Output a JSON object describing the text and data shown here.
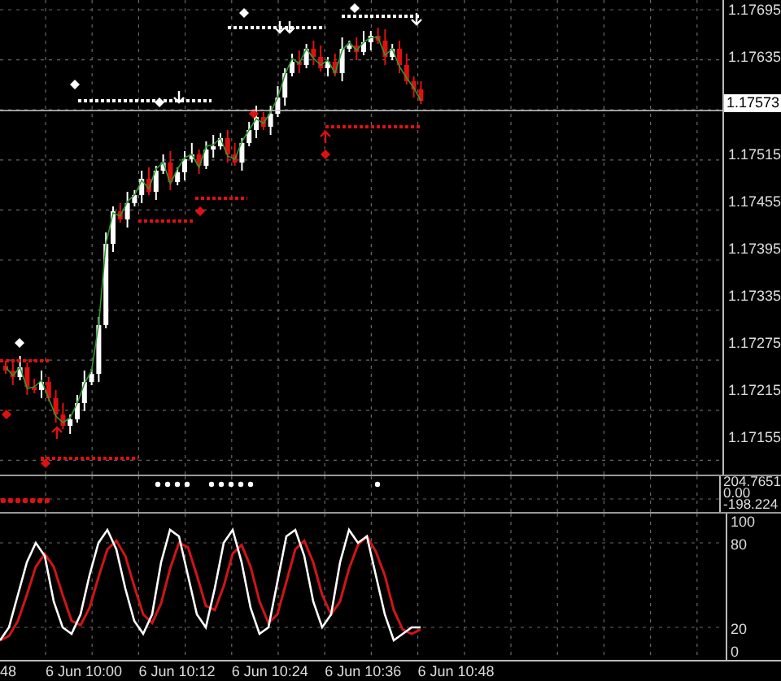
{
  "price_axis": [
    {
      "label": "1.17695",
      "kind": "tick"
    },
    {
      "label": "1.17635",
      "kind": "tick"
    },
    {
      "label": "1.17573",
      "kind": "current"
    },
    {
      "label": "1.17515",
      "kind": "tick"
    },
    {
      "label": "1.17455",
      "kind": "tick"
    },
    {
      "label": "1.17395",
      "kind": "tick"
    },
    {
      "label": "1.17335",
      "kind": "tick"
    },
    {
      "label": "1.17275",
      "kind": "tick"
    },
    {
      "label": "1.17215",
      "kind": "tick"
    },
    {
      "label": "1.17155",
      "kind": "tick"
    }
  ],
  "indicator_axis": [
    "204.7651",
    "0.00",
    "-198.224"
  ],
  "oscillator_axis": [
    "100",
    "80",
    "20",
    "0"
  ],
  "time_axis": [
    "48",
    "6 Jun 10:00",
    "6 Jun 10:12",
    "6 Jun 10:24",
    "6 Jun 10:36",
    "6 Jun 10:48"
  ]
}
